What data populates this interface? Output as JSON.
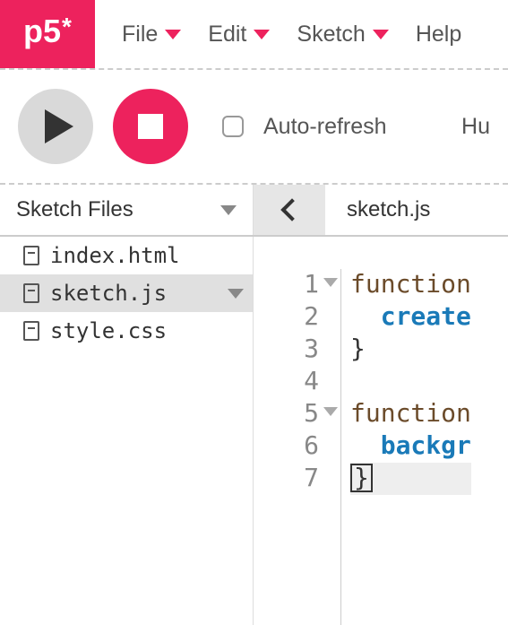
{
  "logo": {
    "text": "p5",
    "sup": "*"
  },
  "menu": {
    "file": "File",
    "edit": "Edit",
    "sketch": "Sketch",
    "help": "Help"
  },
  "toolbar": {
    "auto_refresh": "Auto-refresh",
    "right_label": "Hu"
  },
  "pane": {
    "sketch_files": "Sketch Files",
    "active_file": "sketch.js"
  },
  "files": [
    {
      "name": "index.html",
      "selected": false
    },
    {
      "name": "sketch.js",
      "selected": true
    },
    {
      "name": "style.css",
      "selected": false
    }
  ],
  "code": {
    "lines": [
      {
        "n": 1,
        "fold": true,
        "kw": "function",
        "rest": ""
      },
      {
        "n": 2,
        "fn": "create"
      },
      {
        "n": 3,
        "plain": "}"
      },
      {
        "n": 4,
        "plain": ""
      },
      {
        "n": 5,
        "fold": true,
        "kw": "function",
        "rest": ""
      },
      {
        "n": 6,
        "fn": "backgr"
      },
      {
        "n": 7,
        "current": true,
        "boxed": "}"
      }
    ]
  }
}
